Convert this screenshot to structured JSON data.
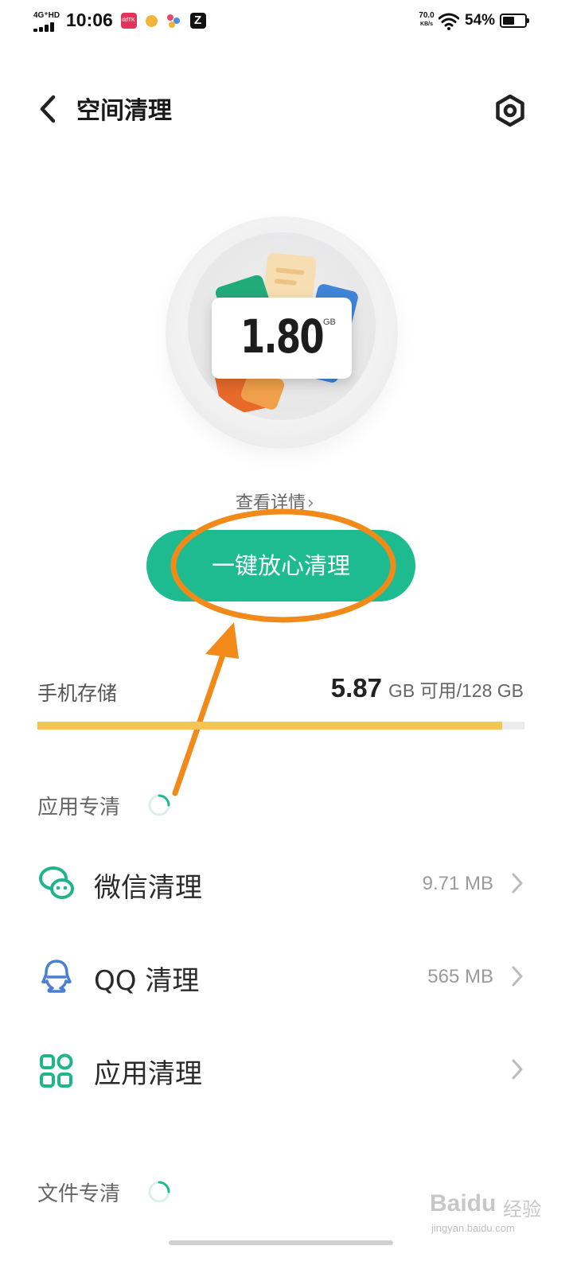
{
  "status_bar": {
    "network": "4G⁺HD",
    "time": "10:06",
    "app_icons": [
      "notification-app-1",
      "notification-app-2",
      "notification-app-3",
      "zhihu-icon"
    ],
    "app_icon_1_text": "ddTK",
    "app_icon_4_text": "Z",
    "speed_value": "70.0",
    "speed_unit": "KB/s",
    "battery_percent": "54%",
    "battery_level": 0.54
  },
  "header": {
    "title": "空间清理",
    "back_icon": "chevron-left-icon",
    "settings_icon": "hexagon-settings-icon"
  },
  "hero": {
    "size_value": "1.80",
    "size_unit": "GB",
    "details_link": "查看详情"
  },
  "primary_action": {
    "label": "一键放心清理"
  },
  "storage": {
    "label": "手机存储",
    "available": "5.87",
    "available_suffix": "GB 可用/128 GB",
    "used_fraction": 0.954
  },
  "sections": {
    "app_clean_header": "应用专清",
    "file_clean_header": "文件专清"
  },
  "app_items": [
    {
      "icon": "wechat-icon",
      "label": "微信清理",
      "value": "9.71 MB"
    },
    {
      "icon": "qq-icon",
      "label": "QQ 清理",
      "value": "565 MB"
    },
    {
      "icon": "apps-grid-icon",
      "label": "应用清理",
      "value": ""
    }
  ],
  "watermark": {
    "text": "Baidu",
    "text_cn": "经验",
    "url": "jingyan.baidu.com"
  },
  "colors": {
    "accent_green": "#1dbb8f",
    "storage_bar": "#f4c552",
    "annotation_orange": "#f28a1a",
    "wechat_green": "#1fb489",
    "qq_blue": "#4a7fd6"
  }
}
